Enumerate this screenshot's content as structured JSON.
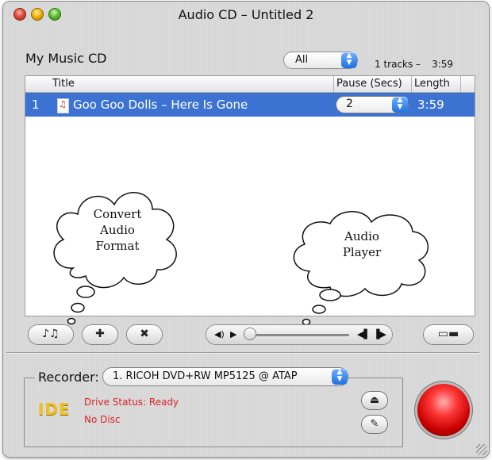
{
  "window": {
    "title": "Audio CD – Untitled 2"
  },
  "header": {
    "section_title": "My Music CD",
    "filter_value": "All",
    "tracks_count": "1 tracks –",
    "total_length": "3:59"
  },
  "columns": {
    "title": "Title",
    "pause": "Pause (Secs)",
    "length": "Length"
  },
  "tracks": [
    {
      "number": "1",
      "title": "Goo Goo Dolls – Here Is Gone",
      "pause": "2",
      "length": "3:59"
    }
  ],
  "callouts": [
    {
      "lines": [
        "Convert",
        "Audio",
        "Format"
      ]
    },
    {
      "lines": [
        "Audio",
        "Player"
      ]
    }
  ],
  "icons": {
    "convert": "music-notes-icon",
    "add": "plus-icon",
    "remove": "close-icon",
    "volume": "volume-icon",
    "play": "play-icon",
    "prev": "previous-track-icon",
    "next": "next-track-icon",
    "drawer": "drawer-toggle-icon",
    "eject": "eject-icon",
    "erase": "erase-icon"
  },
  "recorder": {
    "label": "Recorder:",
    "device": "1. RICOH DVD+RW MP5125 @ ATAP",
    "logo": "IDE",
    "drive_status": "Drive Status: Ready",
    "disc_status": "No Disc"
  },
  "colors": {
    "selection": "#3c73d2",
    "status_red": "#d8232a",
    "burn_red": "#ff3a3a"
  }
}
